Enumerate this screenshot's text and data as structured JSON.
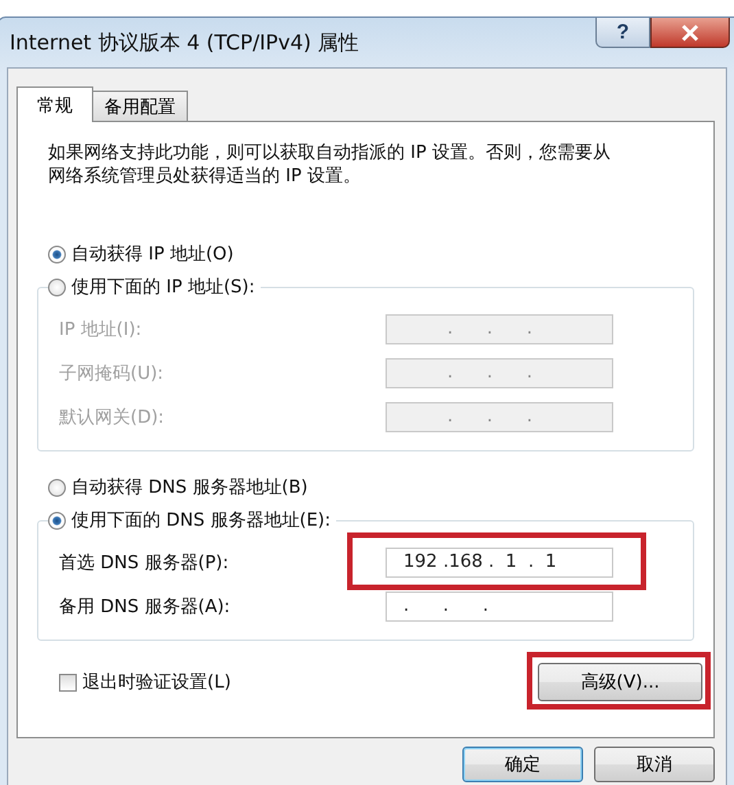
{
  "window": {
    "title": "Internet 协议版本 4 (TCP/IPv4) 属性",
    "help": "?"
  },
  "tabs": [
    {
      "label": "常规",
      "selected": true
    },
    {
      "label": "备用配置",
      "selected": false
    }
  ],
  "intro": "如果网络支持此功能，则可以获取自动指派的 IP 设置。否则，您需要从网络系统管理员处获得适当的 IP 设置。",
  "ip_section": {
    "options": [
      {
        "label": "自动获得 IP 地址(O)",
        "selected": true
      },
      {
        "label": "使用下面的 IP 地址(S):",
        "selected": false
      }
    ],
    "fields": [
      {
        "label": "IP 地址(I):",
        "value": ".      .      .",
        "disabled": true,
        "highlighted": false
      },
      {
        "label": "子网掩码(U):",
        "value": ".      .      .",
        "disabled": true,
        "highlighted": false
      },
      {
        "label": "默认网关(D):",
        "value": ".      .      .",
        "disabled": true,
        "highlighted": false
      }
    ]
  },
  "dns_section": {
    "options": [
      {
        "label": "自动获得 DNS 服务器地址(B)",
        "selected": false
      },
      {
        "label": "使用下面的 DNS 服务器地址(E):",
        "selected": true
      }
    ],
    "fields": [
      {
        "label": "首选 DNS 服务器(P):",
        "value": "192 .168 .  1  .  1",
        "disabled": false,
        "highlighted": true
      },
      {
        "label": "备用 DNS 服务器(A):",
        "value": ".      .      .",
        "disabled": false,
        "highlighted": false
      }
    ]
  },
  "validate": {
    "label": "退出时验证设置(L)",
    "checked": false
  },
  "advanced_button": {
    "label": "高级(V)...",
    "highlighted": true
  },
  "buttons": [
    "确定",
    "取消"
  ]
}
